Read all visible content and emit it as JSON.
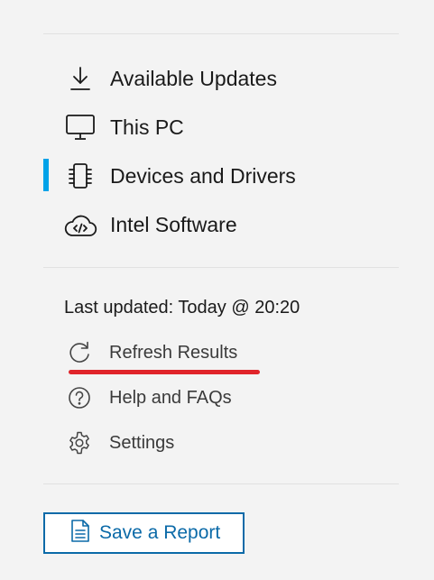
{
  "nav": {
    "items": [
      {
        "label": "Available Updates",
        "icon": "download-icon"
      },
      {
        "label": "This PC",
        "icon": "monitor-icon"
      },
      {
        "label": "Devices and Drivers",
        "icon": "chip-icon",
        "active": true
      },
      {
        "label": "Intel Software",
        "icon": "cloud-code-icon"
      }
    ]
  },
  "status": {
    "last_updated": "Last updated: Today @ 20:20"
  },
  "utilities": {
    "items": [
      {
        "label": "Refresh Results",
        "icon": "refresh-icon"
      },
      {
        "label": "Help and FAQs",
        "icon": "help-icon"
      },
      {
        "label": "Settings",
        "icon": "gear-icon"
      }
    ]
  },
  "report_button": {
    "label": "Save a Report",
    "icon": "document-icon"
  },
  "colors": {
    "accent": "#00a2e8",
    "button": "#0b6aa8",
    "annotation": "#e0242a",
    "background": "#f3f3f3"
  }
}
